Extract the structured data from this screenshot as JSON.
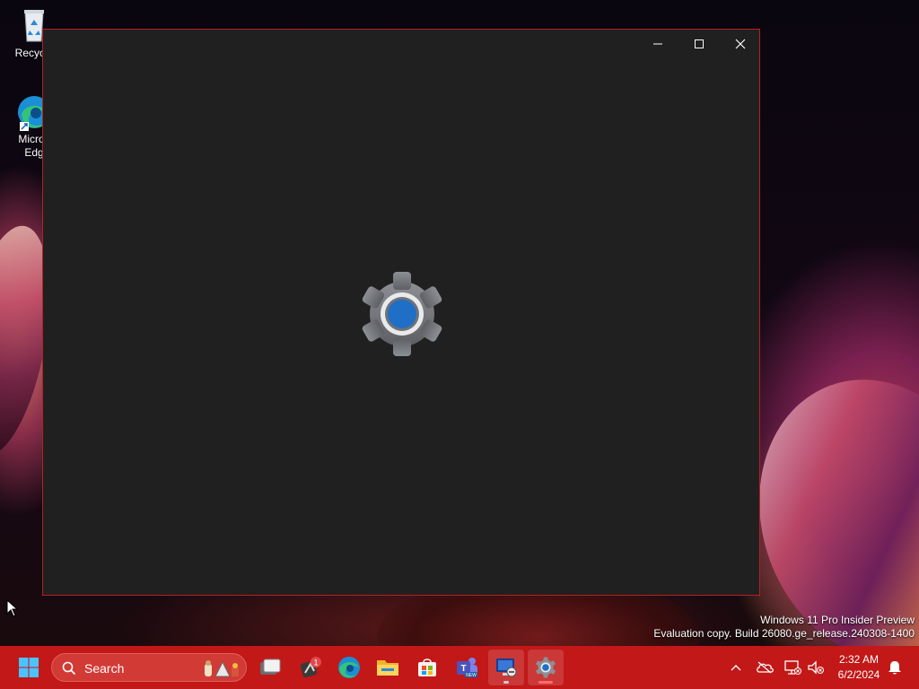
{
  "desktop": {
    "icons": [
      {
        "label": "Recycle",
        "name": "recycle-bin"
      },
      {
        "label_line1": "Micros",
        "label_line2": "Edg",
        "name": "microsoft-edge"
      }
    ]
  },
  "window": {
    "controls": {
      "minimize": "minimize-icon",
      "maximize": "maximize-icon",
      "close": "close-icon"
    },
    "splash_icon": "settings-gear-icon"
  },
  "watermark": {
    "line1": "Windows 11 Pro Insider Preview",
    "line2": "Evaluation copy. Build 26080.ge_release.240308-1400"
  },
  "taskbar": {
    "search_label": "Search",
    "badge_count": "1",
    "pinned": [
      "start-icon",
      "task-view-icon",
      "widgets-icon",
      "edge-icon",
      "file-explorer-icon",
      "store-icon",
      "teams-icon",
      "remote-desktop-icon",
      "settings-icon"
    ],
    "clock": {
      "time": "2:32 AM",
      "date": "6/2/2024"
    },
    "tray": [
      "show-hidden-icons",
      "onedrive-icon",
      "network-icon",
      "volume-icon",
      "notification-bell-icon"
    ]
  },
  "colors": {
    "taskbar": "#c21818",
    "window_bg": "#202020",
    "window_border": "#b22222",
    "accent_blue": "#1f6fc7"
  }
}
